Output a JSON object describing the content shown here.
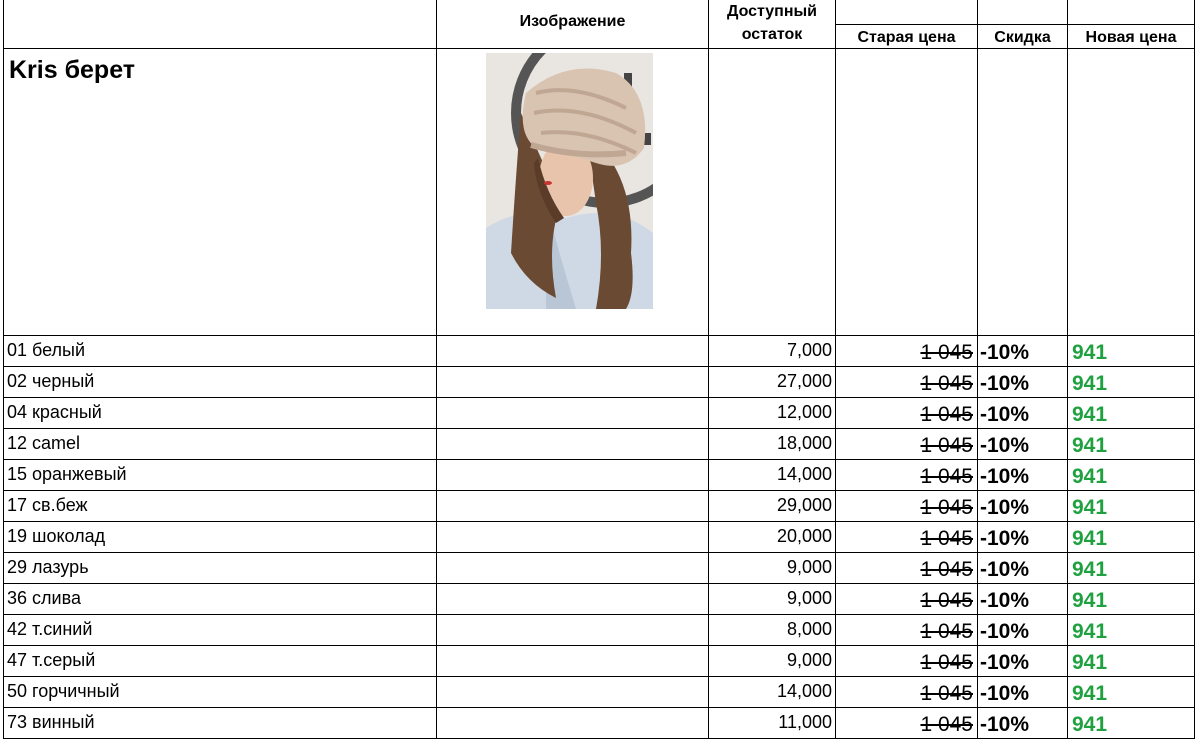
{
  "header": {
    "image_col": "Изображение",
    "stock_col_line1": "Доступный",
    "stock_col_line2": "остаток",
    "old_price_col": "Старая цена",
    "discount_col": "Скидка",
    "new_price_col": "Новая цена"
  },
  "product": {
    "title": "Kris берет"
  },
  "colors": {
    "new_price": "#1fa140",
    "grid": "#000000"
  },
  "rows": [
    {
      "name": "01 белый",
      "stock": "7,000",
      "old": "1 045",
      "discount": "-10%",
      "new": "941"
    },
    {
      "name": "02 черный",
      "stock": "27,000",
      "old": "1 045",
      "discount": "-10%",
      "new": "941"
    },
    {
      "name": "04 красный",
      "stock": "12,000",
      "old": "1 045",
      "discount": "-10%",
      "new": "941"
    },
    {
      "name": "12 camel",
      "stock": "18,000",
      "old": "1 045",
      "discount": "-10%",
      "new": "941"
    },
    {
      "name": "15 оранжевый",
      "stock": "14,000",
      "old": "1 045",
      "discount": "-10%",
      "new": "941"
    },
    {
      "name": "17 св.беж",
      "stock": "29,000",
      "old": "1 045",
      "discount": "-10%",
      "new": "941"
    },
    {
      "name": "19 шоколад",
      "stock": "20,000",
      "old": "1 045",
      "discount": "-10%",
      "new": "941"
    },
    {
      "name": "29 лазурь",
      "stock": "9,000",
      "old": "1 045",
      "discount": "-10%",
      "new": "941"
    },
    {
      "name": "36 слива",
      "stock": "9,000",
      "old": "1 045",
      "discount": "-10%",
      "new": "941"
    },
    {
      "name": "42 т.синий",
      "stock": "8,000",
      "old": "1 045",
      "discount": "-10%",
      "new": "941"
    },
    {
      "name": "47 т.серый",
      "stock": "9,000",
      "old": "1 045",
      "discount": "-10%",
      "new": "941"
    },
    {
      "name": "50 горчичный",
      "stock": "14,000",
      "old": "1 045",
      "discount": "-10%",
      "new": "941"
    },
    {
      "name": "73 винный",
      "stock": "11,000",
      "old": "1 045",
      "discount": "-10%",
      "new": "941"
    }
  ]
}
